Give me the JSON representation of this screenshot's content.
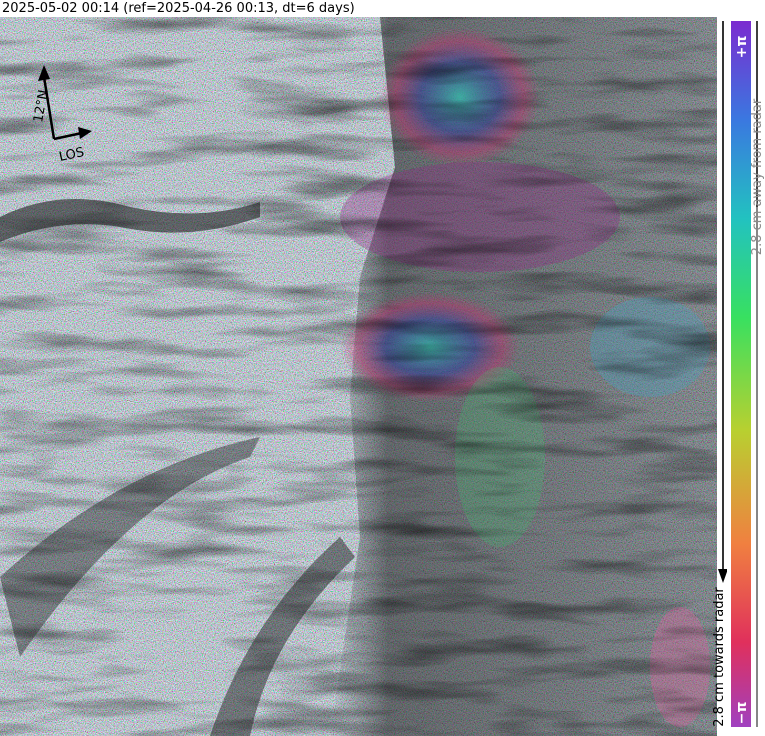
{
  "title": "2025-05-02 00:14 (ref=2025-04-26 00:13, dt=6 days)",
  "north_arrow": {
    "north_label": "12°N",
    "los_label": "LOS"
  },
  "colorbar": {
    "top_label": "+π",
    "bottom_label": "−π",
    "away_label": "2.8 cm away from radar",
    "towards_label": "2.8 cm towards radar",
    "colors": [
      "#7b2bd0",
      "#3a78e0",
      "#22c2c0",
      "#38e060",
      "#b8d030",
      "#f08040",
      "#e0305c",
      "#a040c0"
    ]
  },
  "map": {
    "description_colors": {
      "noise_palette": [
        "#c04080",
        "#40b060",
        "#6060c0",
        "#c0a040",
        "#40a0b0",
        "#a050a0",
        "#70c040",
        "#d06040"
      ],
      "shadow": "#1a1a1a"
    }
  }
}
